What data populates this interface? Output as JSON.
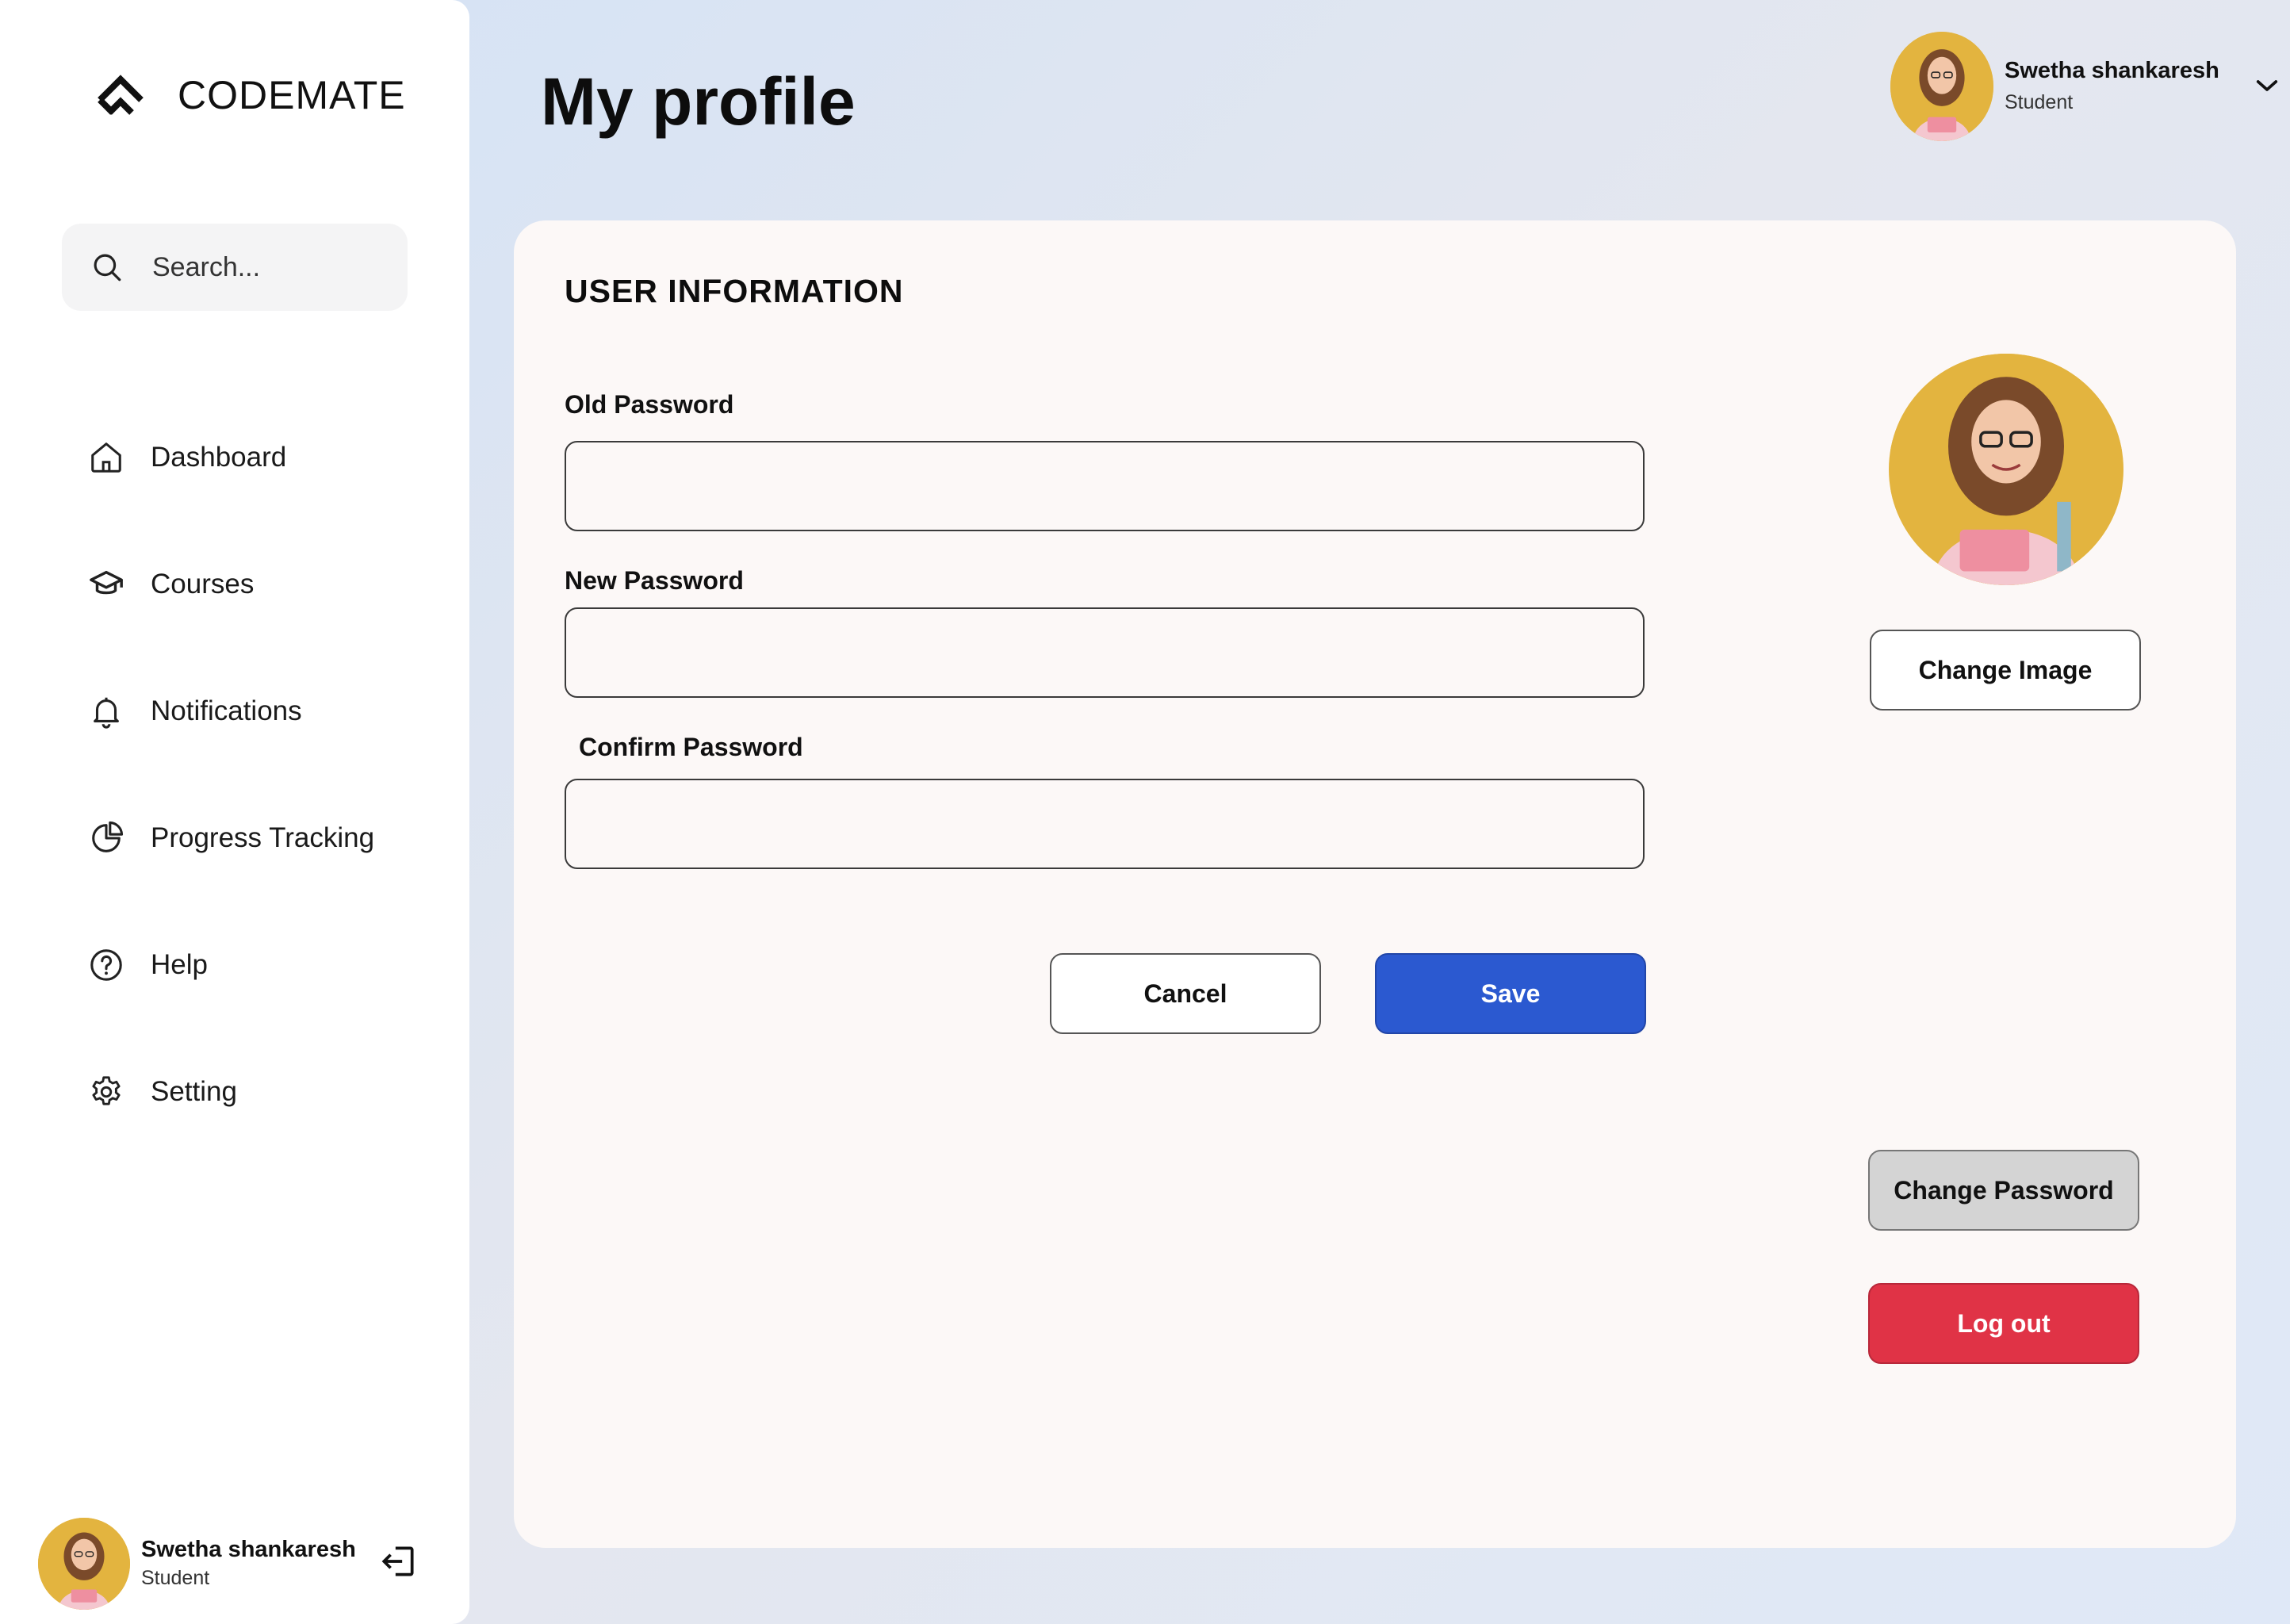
{
  "app": {
    "name": "CODEMATE"
  },
  "search": {
    "placeholder": "Search..."
  },
  "nav": {
    "items": [
      {
        "label": "Dashboard",
        "icon": "home-icon"
      },
      {
        "label": "Courses",
        "icon": "graduation-cap-icon"
      },
      {
        "label": "Notifications",
        "icon": "bell-icon"
      },
      {
        "label": "Progress Tracking",
        "icon": "pie-chart-icon"
      },
      {
        "label": "Help",
        "icon": "help-circle-icon"
      },
      {
        "label": "Setting",
        "icon": "gear-icon"
      }
    ]
  },
  "user": {
    "name": "Swetha shankaresh",
    "role": "Student"
  },
  "page": {
    "title": "My profile"
  },
  "form": {
    "title": "USER INFORMATION",
    "old_password_label": "Old Password",
    "new_password_label": "New Password",
    "confirm_password_label": "Confirm Password",
    "old_password_value": "",
    "new_password_value": "",
    "confirm_password_value": "",
    "cancel_label": "Cancel",
    "save_label": "Save"
  },
  "profile": {
    "change_image_label": "Change Image",
    "change_password_label": "Change Password",
    "logout_label": "Log out"
  },
  "colors": {
    "primary": "#2b59d0",
    "danger": "#e03346",
    "avatar_bg": "#e3b43f"
  }
}
